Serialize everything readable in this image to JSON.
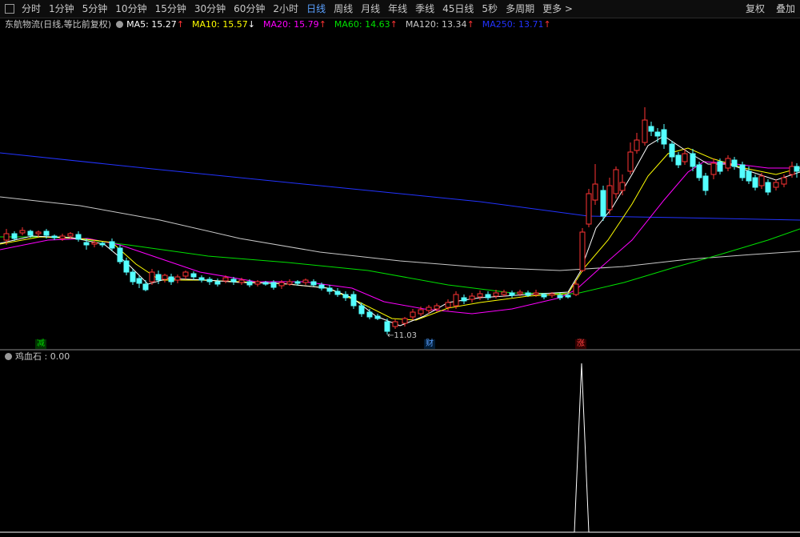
{
  "toolbar": {
    "tabs": [
      {
        "label": "分时"
      },
      {
        "label": "1分钟"
      },
      {
        "label": "5分钟"
      },
      {
        "label": "10分钟"
      },
      {
        "label": "15分钟"
      },
      {
        "label": "30分钟"
      },
      {
        "label": "60分钟"
      },
      {
        "label": "2小时"
      },
      {
        "label": "日线",
        "active": true
      },
      {
        "label": "周线"
      },
      {
        "label": "月线"
      },
      {
        "label": "年线"
      },
      {
        "label": "季线"
      },
      {
        "label": "45日线"
      },
      {
        "label": "5秒"
      },
      {
        "label": "多周期"
      },
      {
        "label": "更多 >"
      }
    ],
    "fuquan_label": "复权",
    "overlay_label": "叠加"
  },
  "main_panel": {
    "stock_label": "东航物流(日线,等比前复权)",
    "indicators": [
      {
        "label": "MA5: 15.27",
        "arrow": "↑",
        "color": "#ffffff"
      },
      {
        "label": "MA10: 15.57",
        "arrow": "↓",
        "color": "#ffff00"
      },
      {
        "label": "MA20: 15.79",
        "arrow": "↑",
        "color": "#ff00ff"
      },
      {
        "label": "MA60: 14.63",
        "arrow": "↑",
        "color": "#00e000"
      },
      {
        "label": "MA120: 13.34",
        "arrow": "↑",
        "color": "#c8c8c8"
      },
      {
        "label": "MA250: 13.71",
        "arrow": "↑",
        "color": "#2233ff"
      }
    ],
    "low_label": "←11.03",
    "markers": [
      {
        "text": "减",
        "color": "#00d000",
        "bg": "#003300"
      },
      {
        "text": "财",
        "color": "#5aa0ff",
        "bg": "#001a33"
      },
      {
        "text": "涨",
        "color": "#ff4040",
        "bg": "#330000"
      }
    ]
  },
  "sub_panel": {
    "indicator_label": "鸡血石 : 0.00"
  },
  "colors": {
    "up": "#ff3333",
    "down": "#54ffff",
    "ma5": "#ffffff",
    "ma10": "#ffff00",
    "ma20": "#ff00ff",
    "ma60": "#00e000",
    "ma120": "#c8c8c8",
    "ma250": "#2233ff"
  }
}
